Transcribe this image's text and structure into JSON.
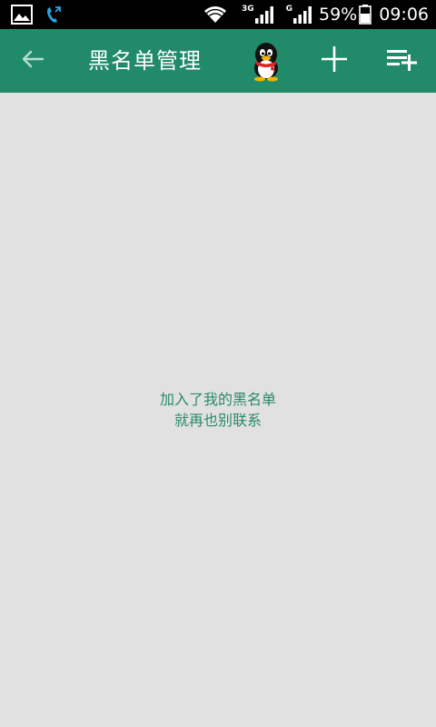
{
  "status_bar": {
    "icons_left": [
      "gallery-icon",
      "call-forward-icon"
    ],
    "net_primary": "3G",
    "net_secondary": "G",
    "battery_percent": "59%",
    "time": "09:06"
  },
  "app_bar": {
    "title": "黑名单管理",
    "icons": [
      "back-arrow-icon",
      "qq-penguin-icon",
      "add-icon",
      "add-list-icon"
    ]
  },
  "empty_state": {
    "line1": "加入了我的黑名单",
    "line2": "就再也别联系"
  },
  "colors": {
    "primary": "#218a69",
    "background": "#e1e1e1",
    "empty_text": "#2a8a67",
    "status_bar": "#000000"
  }
}
